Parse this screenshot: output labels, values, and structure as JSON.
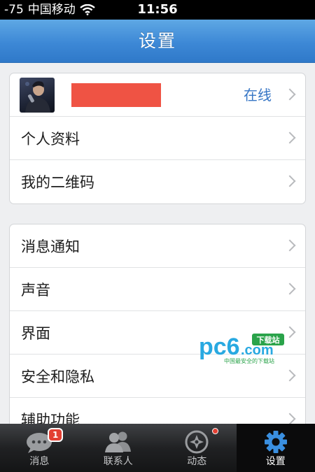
{
  "status_bar": {
    "signal": "-75",
    "carrier": "中国移动",
    "time": "11:56",
    "wifi_icon": "wifi-icon"
  },
  "nav": {
    "title": "设置"
  },
  "profile": {
    "status": "在线",
    "name_redacted": true,
    "redact_color": "#ef5344"
  },
  "group1": {
    "items": [
      {
        "label": "个人资料"
      },
      {
        "label": "我的二维码"
      }
    ]
  },
  "group2": {
    "items": [
      {
        "label": "消息通知"
      },
      {
        "label": "声音"
      },
      {
        "label": "界面"
      },
      {
        "label": "安全和隐私"
      },
      {
        "label": "辅助功能"
      }
    ]
  },
  "watermark": {
    "logo": "pc6",
    "suffix": ".com",
    "tag": "下载站",
    "slogan": "中国最安全的下载站"
  },
  "tabbar": {
    "tabs": [
      {
        "label": "消息",
        "icon": "chat-bubble-icon",
        "badge": "1"
      },
      {
        "label": "联系人",
        "icon": "contacts-icon"
      },
      {
        "label": "动态",
        "icon": "compass-icon",
        "dot": true
      },
      {
        "label": "设置",
        "icon": "gear-icon",
        "active": true
      }
    ]
  },
  "colors": {
    "nav": "#3d88d6",
    "accent": "#3776c5",
    "badge": "#e34033",
    "active_tab_icon": "#3a8fe0"
  }
}
